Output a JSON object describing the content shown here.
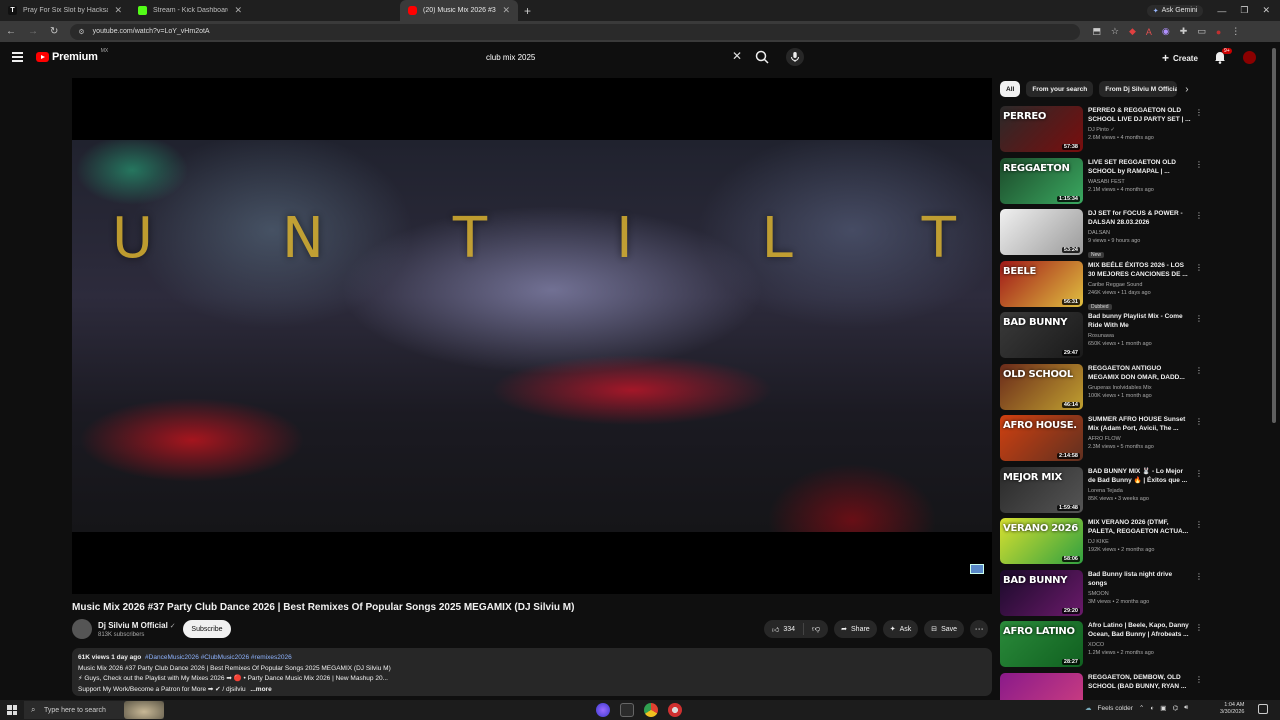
{
  "browser": {
    "tabs": [
      {
        "title": "Pray For Six Slot by Hacksaw -",
        "color": "#ffffff"
      },
      {
        "title": "Stream - Kick Dashboard",
        "color": "#53fc18"
      },
      {
        "title": "(20) Music Mix 2026 #37 P...",
        "color": "#ff0000"
      }
    ],
    "ask_gemini": "Ask Gemini",
    "url": "youtube.com/watch?v=LoY_vHm2otA"
  },
  "header": {
    "logo": "Premium",
    "logo_sup": "MX",
    "search_value": "club mix 2025",
    "create_label": "Create",
    "notif_badge": "9+"
  },
  "player": {
    "overlay_letters": [
      "U",
      "N",
      "T",
      "I",
      "L",
      "T"
    ]
  },
  "video": {
    "title": "Music Mix 2026 #37 Party Club Dance 2026 | Best Remixes Of Popular Songs 2025 MEGAMIX (DJ Silviu M)",
    "channel": "Dj Silviu M Official",
    "verified": "✓",
    "subscribers": "813K subscribers",
    "subscribe_label": "Subscribe",
    "likes": "334",
    "share_label": "Share",
    "ask_label": "Ask",
    "save_label": "Save"
  },
  "description": {
    "meta": "61K views  1 day ago",
    "tags": "#DanceMusic2026 #ClubMusic2026 #remixes2026",
    "line1": "Music Mix 2026 #37 Party Club Dance 2026 | Best Remixes Of Popular Songs 2025 MEGAMIX (DJ Silviu M)",
    "line2": "⚡ Guys, Check out the Playlist with My Mixes 2026 ➡ 🔴 • Party Dance Music Mix 2026 | New Mashup 20...",
    "line3": "Support My Work/Become a Patron for More ➡ ✔ / djsilviu",
    "more": "...more"
  },
  "chips": [
    "All",
    "From your search",
    "From Dj Silviu M Official"
  ],
  "recommendations": [
    {
      "title": "PERREO & REGGAETON OLD SCHOOL LIVE DJ PARTY SET | ...",
      "channel": "DJ Pinto ✓",
      "views": "2.6M views • 4 months ago",
      "duration": "57:38",
      "thumb_text": "PERREO",
      "c1": "#2a2a2a",
      "c2": "#7a0d0d",
      "badge": ""
    },
    {
      "title": "LIVE SET REGGAETON OLD SCHOOL by RAMAPAL | ...",
      "channel": "WASABI FEST",
      "views": "2.1M views • 4 months ago",
      "duration": "1:15:34",
      "thumb_text": "REGGAETON",
      "c1": "#1c4a2a",
      "c2": "#3aa860",
      "badge": ""
    },
    {
      "title": "DJ SET for FOCUS & POWER - DALSAN 28.03.2026",
      "channel": "DALSAN",
      "views": "9 views • 9 hours ago",
      "duration": "53:24",
      "thumb_text": "",
      "c1": "#f0f0f0",
      "c2": "#9a9a9a",
      "badge": "New"
    },
    {
      "title": "MIX BEÉLE ÉXITOS 2026 - LOS 30 MEJORES CANCIONES DE ...",
      "channel": "Caribe Reggae Sound",
      "views": "246K views • 11 days ago",
      "duration": "56:31",
      "thumb_text": "BEELE",
      "c1": "#a01818",
      "c2": "#e0c040",
      "badge": "Dubbed"
    },
    {
      "title": "Bad bunny Playlist Mix - Come Ride With Me",
      "channel": "Rosunawa",
      "views": "650K views • 1 month ago",
      "duration": "29:47",
      "thumb_text": "BAD BUNNY",
      "c1": "#3a3a3a",
      "c2": "#1a1a1a",
      "badge": ""
    },
    {
      "title": "REGGAETON ANTIGUO MEGAMIX   DON OMAR, DADD...",
      "channel": "Gruperas Inolvidables Mix",
      "views": "100K views • 1 month ago",
      "duration": "46:14",
      "thumb_text": "OLD SCHOOL",
      "c1": "#6a2a1a",
      "c2": "#c0a030",
      "badge": ""
    },
    {
      "title": "SUMMER AFRO HOUSE Sunset Mix (Adam Port, Avicii, The ...",
      "channel": "AFRO FLOW",
      "views": "2.3M views • 5 months ago",
      "duration": "2:14:58",
      "thumb_text": "AFRO HOUSE.",
      "c1": "#d04010",
      "c2": "#603020",
      "badge": ""
    },
    {
      "title": "BAD BUNNY MIX 🐰 - Lo Mejor de Bad Bunny 🔥 | Éxitos que ...",
      "channel": "Lorena Tejada",
      "views": "85K views • 3 weeks ago",
      "duration": "1:59:48",
      "thumb_text": "MEJOR MIX",
      "c1": "#2a2a2a",
      "c2": "#555555",
      "badge": ""
    },
    {
      "title": "MIX VERANO 2026 (DTMF, PALETA, REGGAETON ACTUA...",
      "channel": "DJ KIKE",
      "views": "192K views • 2 months ago",
      "duration": "58:06",
      "thumb_text": "VERANO 2026",
      "c1": "#d8e030",
      "c2": "#30a040",
      "badge": ""
    },
    {
      "title": "Bad Bunny lista night drive songs",
      "channel": "SMOON",
      "views": "3M views • 2 months ago",
      "duration": "29:20",
      "thumb_text": "BAD BUNNY",
      "c1": "#1a0a2a",
      "c2": "#6a1a6a",
      "badge": ""
    },
    {
      "title": "Afro Latino | Beele, Kapo, Danny Ocean, Bad Bunny | Afrobeats ...",
      "channel": "XOCO",
      "views": "1.2M views • 2 months ago",
      "duration": "28:27",
      "thumb_text": "AFRO LATINO",
      "c1": "#2a8a3a",
      "c2": "#106020",
      "badge": ""
    },
    {
      "title": "REGGAETON, DEMBOW, OLD SCHOOL (BAD BUNNY, RYAN ...",
      "channel": "",
      "views": "",
      "duration": "",
      "thumb_text": "",
      "c1": "#8a1a8a",
      "c2": "#d04080",
      "badge": ""
    }
  ],
  "taskbar": {
    "search_placeholder": "Type here to search",
    "weather": "Feels colder",
    "time": "1:04 AM",
    "date": "3/30/2026"
  }
}
